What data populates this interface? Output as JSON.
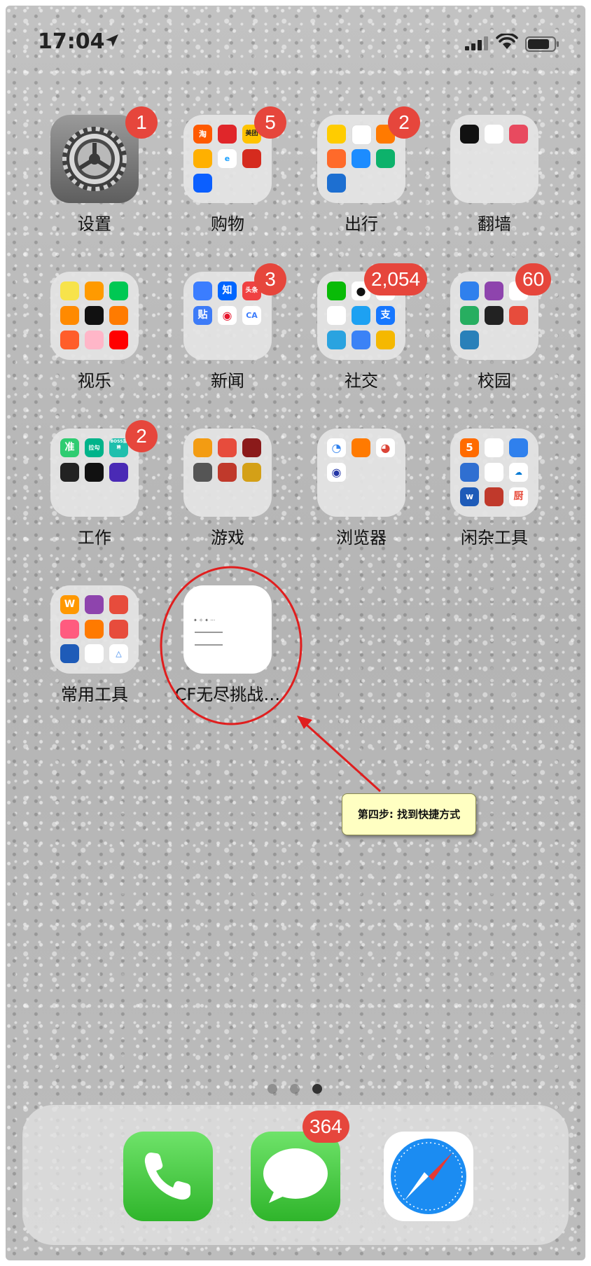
{
  "status_bar": {
    "time": "17:04"
  },
  "apps": {
    "settings": {
      "label": "设置",
      "badge": "1"
    },
    "shopping": {
      "label": "购物",
      "badge": "5",
      "mini": [
        "淘",
        "",
        "美团",
        "",
        "e",
        "",
        "",
        "",
        ""
      ]
    },
    "travel": {
      "label": "出行",
      "badge": "2"
    },
    "vpn": {
      "label": "翻墙"
    },
    "video": {
      "label": "视乐"
    },
    "news": {
      "label": "新闻",
      "badge": "3",
      "mini": [
        "",
        "知",
        "头条",
        "贴",
        "",
        ""
      ]
    },
    "social": {
      "label": "社交",
      "badge": "2,054",
      "mini": [
        "",
        "",
        "",
        "",
        "",
        "支",
        "",
        "",
        ""
      ]
    },
    "campus": {
      "label": "校园",
      "badge": "60"
    },
    "work": {
      "label": "工作",
      "badge": "2",
      "mini": [
        "准",
        "拉勾",
        "BOSS直聘"
      ]
    },
    "games": {
      "label": "游戏"
    },
    "browser": {
      "label": "浏览器"
    },
    "tools_misc": {
      "label": "闲杂工具",
      "mini": [
        "5",
        "",
        "",
        "",
        "",
        "",
        "w",
        "",
        "厨"
      ]
    },
    "tools_common": {
      "label": "常用工具",
      "mini": [
        "W"
      ]
    },
    "cf_shortcut": {
      "label": "CF无尽挑战…"
    }
  },
  "annotation": {
    "callout_text": "第四步: 找到快捷方式"
  },
  "page_indicator": {
    "count": 3,
    "active": 3
  },
  "dock": {
    "messages_badge": "364"
  },
  "colors": {
    "badge": "#e6463c",
    "annotation_red": "#e01e1e",
    "callout_bg": "#ffffc2"
  },
  "icons": [
    "location-arrow-icon",
    "signal-icon",
    "wifi-icon",
    "battery-icon",
    "phone-icon",
    "messages-icon",
    "safari-icon"
  ]
}
